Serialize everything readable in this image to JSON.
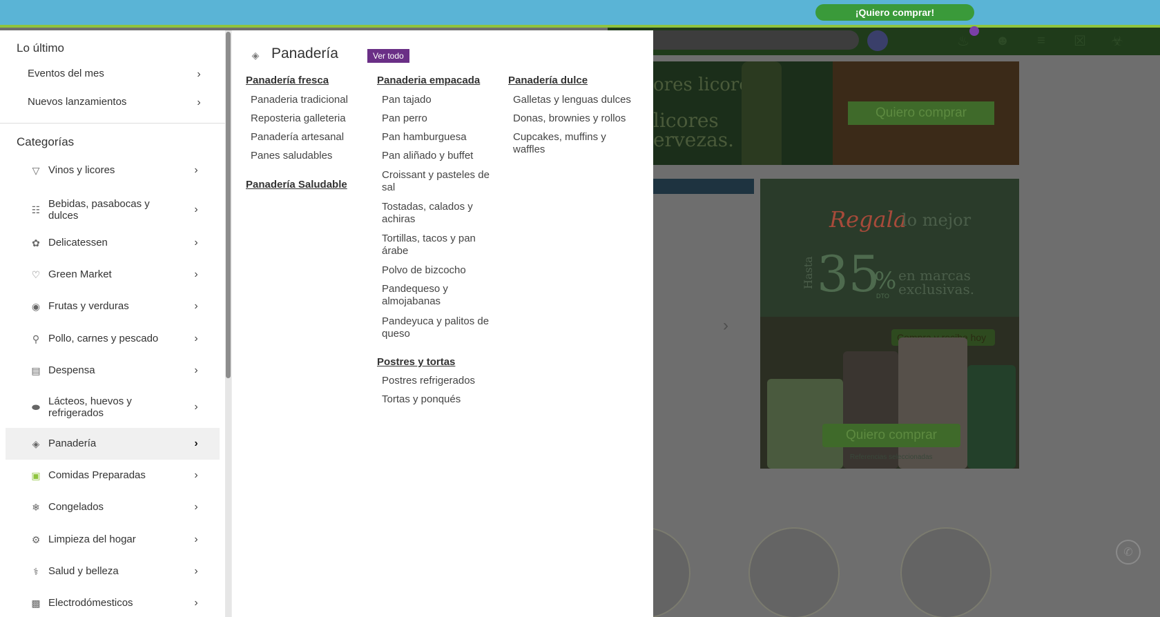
{
  "topbar": {
    "cta": "¡Quiero comprar!"
  },
  "header": {
    "icons": [
      "search-icon",
      "bell-icon",
      "user-icon",
      "list-icon",
      "basket-icon",
      "cart-icon"
    ],
    "notification_count": ""
  },
  "banner1": {
    "line1": "ores licores",
    "line2": "licores",
    "line3": "ervezas.",
    "cta": "Quiero comprar"
  },
  "banner2": {
    "regala": "Regala",
    "regala_rest": "lo mejor",
    "hasta": "Hasta",
    "discount": "35",
    "pct": "%",
    "dto": "DTO",
    "exclusivas_1": "en marcas",
    "exclusivas_2": "exclusivas.",
    "compra": "Compra y recibe",
    "compra_tag": "hoy",
    "cta": "Quiero comprar",
    "refs": "Referencias seleccionadas"
  },
  "sidebar": {
    "lo_ultimo_title": "Lo último",
    "lo_ultimo": [
      {
        "label": "Eventos del mes"
      },
      {
        "label": "Nuevos lanzamientos"
      }
    ],
    "categorias_title": "Categorías",
    "categories": [
      {
        "label": "Vinos y licores",
        "icon": "wine-glass-icon"
      },
      {
        "label": "Bebidas, pasabocas y dulces",
        "icon": "snacks-icon"
      },
      {
        "label": "Delicatessen",
        "icon": "delicatessen-icon"
      },
      {
        "label": "Green Market",
        "icon": "heart-icon"
      },
      {
        "label": "Frutas y verduras",
        "icon": "fruit-icon"
      },
      {
        "label": "Pollo, carnes y pescado",
        "icon": "drumstick-icon"
      },
      {
        "label": "Despensa",
        "icon": "pantry-icon"
      },
      {
        "label": "Lácteos, huevos y refrigerados",
        "icon": "egg-icon"
      },
      {
        "label": "Panadería",
        "icon": "bread-icon",
        "active": true
      },
      {
        "label": "Comidas Preparadas",
        "icon": "prepared-food-icon"
      },
      {
        "label": "Congelados",
        "icon": "frozen-icon"
      },
      {
        "label": "Limpieza del hogar",
        "icon": "cleaning-icon"
      },
      {
        "label": "Salud y belleza",
        "icon": "health-icon"
      },
      {
        "label": "Electrodómesticos",
        "icon": "appliance-icon"
      }
    ]
  },
  "panel": {
    "title": "Panadería",
    "ver_todo": "Ver todo",
    "col1": {
      "groups": [
        {
          "heading": "Panadería fresca",
          "items": [
            "Panaderia tradicional",
            "Reposteria galleteria",
            "Panadería artesanal",
            "Panes saludables"
          ]
        },
        {
          "heading": "Panadería Saludable",
          "items": []
        }
      ]
    },
    "col2": {
      "groups": [
        {
          "heading": "Panaderia empacada",
          "items": [
            "Pan tajado",
            "Pan perro",
            "Pan hamburguesa",
            "Pan aliñado y buffet",
            "Croissant y pasteles de sal",
            "Tostadas, calados y achiras",
            "Tortillas, tacos y pan árabe",
            "Polvo de bizcocho",
            "Pandequeso y almojabanas",
            "Pandeyuca y palitos de queso"
          ]
        },
        {
          "heading": "Postres y tortas",
          "items": [
            "Postres refrigerados",
            "Tortas y ponqués"
          ]
        }
      ]
    },
    "col3": {
      "groups": [
        {
          "heading": "Panadería dulce",
          "items": [
            "Galletas y lenguas dulces",
            "Donas, brownies y rollos",
            "Cupcakes, muffins y waffles"
          ]
        }
      ]
    }
  }
}
